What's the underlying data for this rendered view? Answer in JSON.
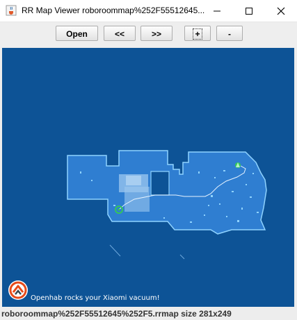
{
  "window": {
    "title": "RR Map Viewer roboroommap%252F55512645...",
    "app_icon": "java-cup-icon"
  },
  "toolbar": {
    "buttons": [
      {
        "label": "Open"
      },
      {
        "label": "<<"
      },
      {
        "label": ">>"
      },
      {
        "label": "+"
      },
      {
        "label": "-"
      }
    ]
  },
  "map": {
    "overlay_text": "Openhab rocks your Xiaomi vacuum!",
    "logo": "openhab-logo-icon",
    "colors": {
      "background": "#0d5396",
      "floor": "#2f7ed1",
      "wall": "#8fd3ff",
      "path": "#e8f4ff",
      "robot": "#34c759",
      "dock": "#34c759"
    }
  },
  "status": {
    "text": "roboroommap%252F55512645%252F5.rrmap size 281x249"
  }
}
